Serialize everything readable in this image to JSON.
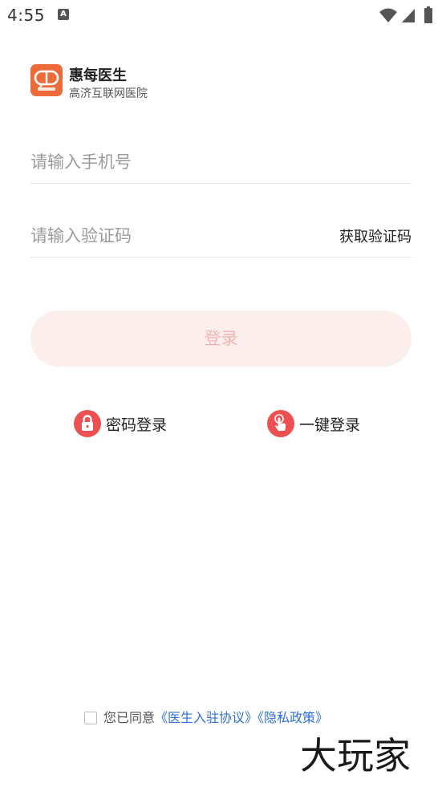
{
  "status_bar": {
    "time": "4:55",
    "notification_icon": "a-icon",
    "notification_glyph": "A",
    "wifi_icon": "wifi-icon",
    "signal_icon": "signal-icon",
    "battery_icon": "battery-icon"
  },
  "brand": {
    "name": "惠每医生",
    "subtitle": "高济互联网医院",
    "logo_icon": "speech-bubble-logo-icon",
    "logo_color": "#ef6a3a"
  },
  "form": {
    "phone_placeholder": "请输入手机号",
    "phone_value": "",
    "code_placeholder": "请输入验证码",
    "code_value": "",
    "get_code_label": "获取验证码"
  },
  "login_button": {
    "label": "登录",
    "background": "#fdeeee",
    "text_color": "#f4b5b3"
  },
  "alt_logins": [
    {
      "label": "密码登录",
      "icon": "lock-icon"
    },
    {
      "label": "一键登录",
      "icon": "tap-hand-icon"
    }
  ],
  "alt_icon_color": "#ec5050",
  "agreement": {
    "prefix": "您已同意",
    "doctor_agreement": "《医生入驻协议》",
    "privacy_policy": "《隐私政策》",
    "checked": false,
    "link_color": "#2f6fd6"
  },
  "watermark": {
    "text": "大玩家"
  }
}
